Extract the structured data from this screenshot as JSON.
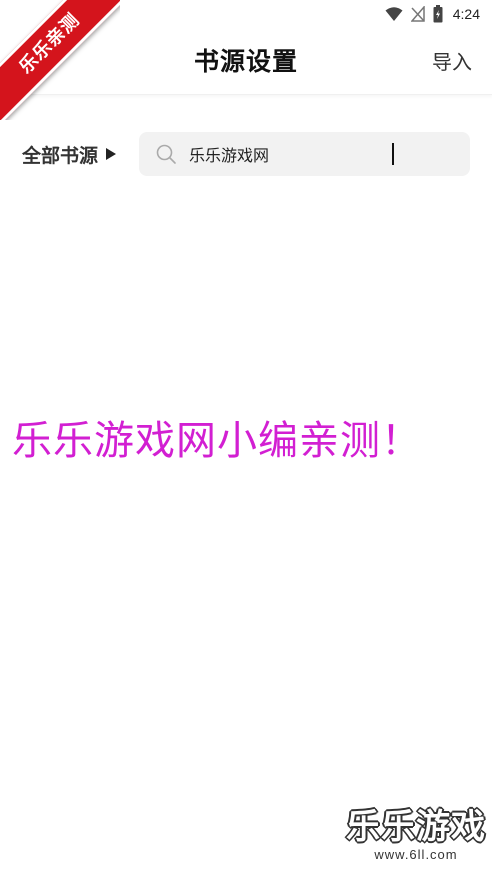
{
  "status_bar": {
    "time": "4:24"
  },
  "header": {
    "title": "书源设置",
    "import_label": "导入"
  },
  "ribbon": {
    "text": "乐乐亲测"
  },
  "filter": {
    "source_label": "全部书源"
  },
  "search": {
    "value": "乐乐游戏网"
  },
  "watermark": {
    "caption": "乐乐游戏网小编亲测！"
  },
  "brand": {
    "title": "乐乐游戏",
    "url": "www.6ll.com"
  },
  "colors": {
    "ribbon": "#d4141c",
    "caption": "#d21fd2",
    "search_bg": "#f2f2f2"
  }
}
